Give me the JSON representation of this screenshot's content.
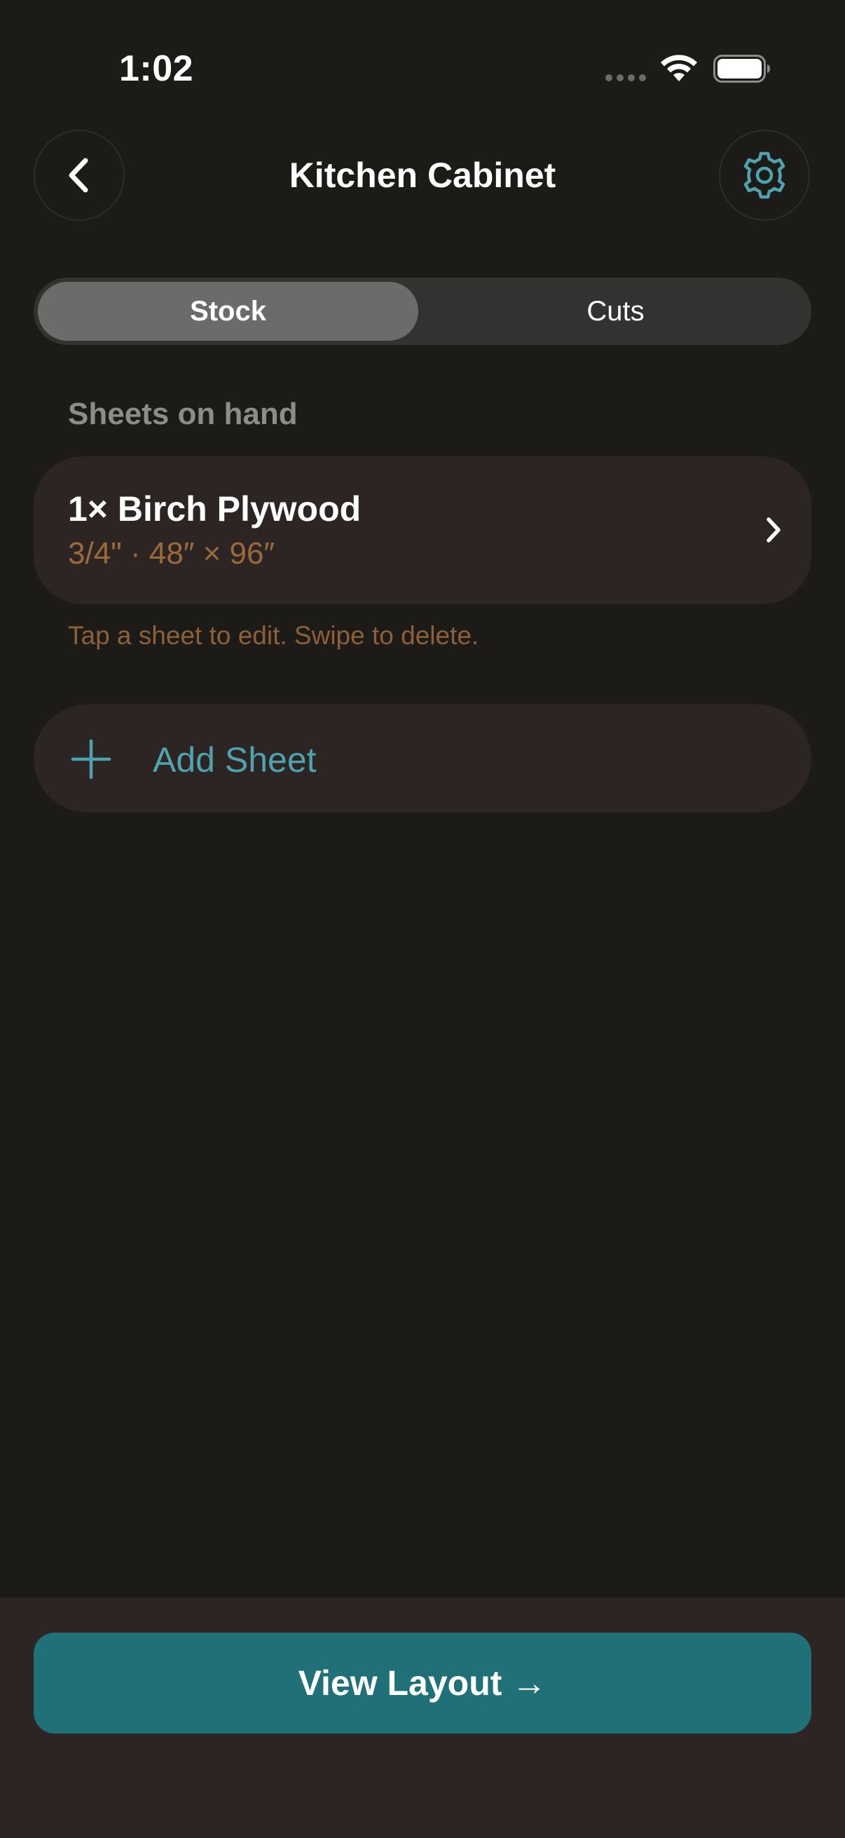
{
  "status_bar": {
    "time": "1:02"
  },
  "header": {
    "title": "Kitchen Cabinet",
    "back_icon": "chevron-left-icon",
    "settings_icon": "gear-icon"
  },
  "segments": {
    "items": [
      "Stock",
      "Cuts"
    ],
    "selected": "Stock"
  },
  "stock": {
    "section_label": "Sheets on hand",
    "sheets": [
      {
        "title": "1× Birch Plywood",
        "subtitle": "3/4\" · 48″ × 96″"
      }
    ],
    "hint": "Tap a sheet to edit. Swipe to delete.",
    "add_label": "Add Sheet"
  },
  "footer": {
    "primary_label": "View Layout",
    "primary_arrow": "→"
  },
  "colors": {
    "background": "#1c1b18",
    "card": "#2c2523",
    "accent": "#4fa3ae",
    "primary_button": "#207078",
    "subtitle_brown": "#9a6a3c"
  }
}
